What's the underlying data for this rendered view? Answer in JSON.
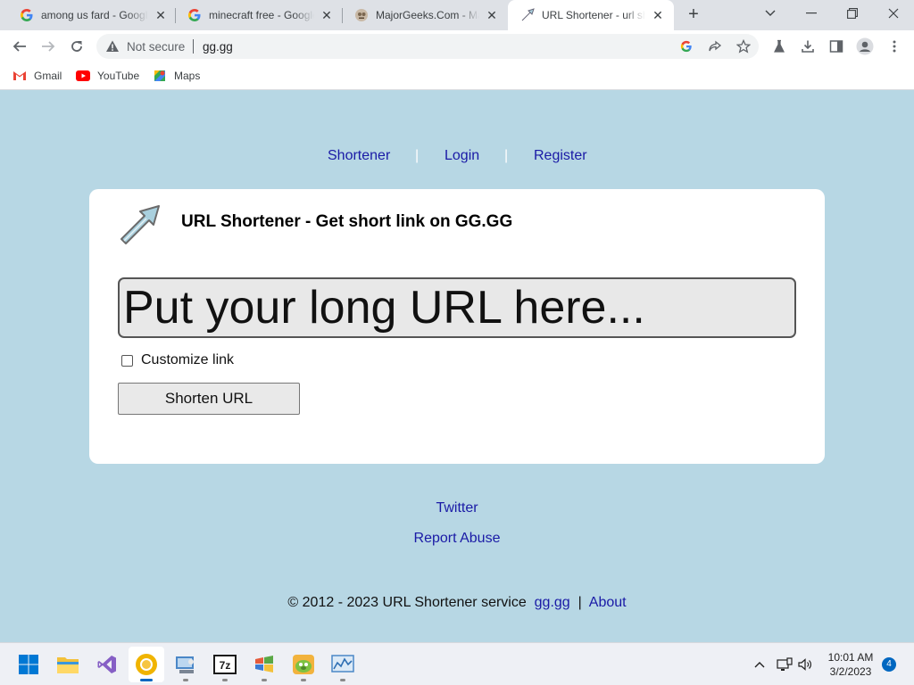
{
  "browser": {
    "tabs": [
      {
        "title": "among us fard - Google Search",
        "favicon": "google-g-icon"
      },
      {
        "title": "minecraft free - Google Search",
        "favicon": "google-g-icon"
      },
      {
        "title": "MajorGeeks.Com - MajorGeeks",
        "favicon": "majorgeeks-icon"
      },
      {
        "title": "URL Shortener - url shortener",
        "favicon": "arrow-favicon-icon",
        "active": true
      }
    ],
    "address": {
      "security_label": "Not secure",
      "url": "gg.gg"
    },
    "bookmarks": [
      {
        "label": "Gmail",
        "icon": "gmail-icon"
      },
      {
        "label": "YouTube",
        "icon": "youtube-icon"
      },
      {
        "label": "Maps",
        "icon": "maps-icon"
      }
    ]
  },
  "page": {
    "nav": {
      "shortener": "Shortener",
      "login": "Login",
      "register": "Register",
      "separator": "|"
    },
    "card": {
      "title": "URL Shortener - Get short link on GG.GG",
      "input_placeholder": "Put your long URL here...",
      "customize_label": "Customize link",
      "customize_checked": false,
      "submit_label": "Shorten URL"
    },
    "footer": {
      "twitter": "Twitter",
      "report": "Report Abuse",
      "copyright": "© 2012 - 2023 URL Shortener service",
      "site_link": "gg.gg",
      "separator": "|",
      "about": "About"
    }
  },
  "taskbar": {
    "apps": [
      {
        "name": "start-button"
      },
      {
        "name": "file-explorer"
      },
      {
        "name": "visual-studio"
      },
      {
        "name": "chrome",
        "active": true
      },
      {
        "name": "control-panel"
      },
      {
        "name": "7zip"
      },
      {
        "name": "windows-app"
      },
      {
        "name": "angry-birds"
      },
      {
        "name": "resource-monitor"
      }
    ],
    "clock": {
      "time": "10:01 AM",
      "date": "3/2/2023"
    },
    "notification_count": "4"
  },
  "colors": {
    "page_background": "#b7d7e4",
    "link": "#1a1aa6",
    "card": "#ffffff"
  }
}
